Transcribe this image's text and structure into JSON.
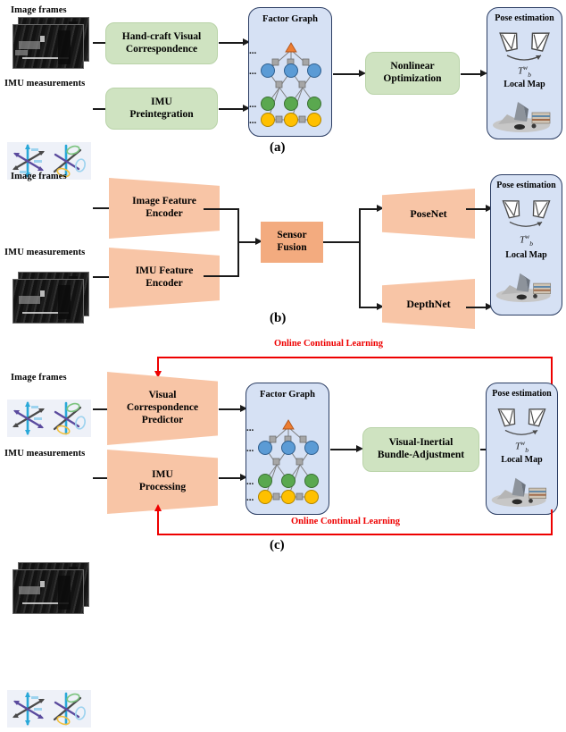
{
  "figure": {
    "panels": [
      {
        "letter": "(a)",
        "inputs": [
          {
            "label": "Image frames",
            "icon": "image-frames-icon"
          },
          {
            "label": "IMU measurements",
            "icon": "imu-axes-icon"
          }
        ],
        "blocks": [
          {
            "label": "Hand-craft Visual Correspondence",
            "line1": "Hand-craft Visual",
            "line2": "Correspondence",
            "style": "green-rounded"
          },
          {
            "label": "IMU Preintegration",
            "line1": "IMU",
            "line2": "Preintegration",
            "style": "green-rounded"
          },
          {
            "label": "Nonlinear Optimization",
            "line1": "Nonlinear",
            "line2": "Optimization",
            "style": "green-rounded"
          }
        ],
        "factor_graph": {
          "title": "Factor Graph",
          "ellipsis": "..."
        },
        "output": {
          "pose_title": "Pose estimation",
          "transform": "T",
          "transform_sup": "w",
          "transform_sub": "b",
          "map_title": "Local Map"
        }
      },
      {
        "letter": "(b)",
        "inputs": [
          {
            "label": "Image frames",
            "icon": "image-frames-icon"
          },
          {
            "label": "IMU measurements",
            "icon": "imu-axes-icon"
          }
        ],
        "blocks": [
          {
            "label": "Image Feature Encoder",
            "line1": "Image Feature",
            "line2": "Encoder",
            "style": "salmon-trapezoid-encoder"
          },
          {
            "label": "IMU Feature Encoder",
            "line1": "IMU Feature",
            "line2": "Encoder",
            "style": "salmon-trapezoid-encoder"
          },
          {
            "label": "Sensor Fusion",
            "line1": "Sensor",
            "line2": "Fusion",
            "style": "salmon-rect"
          },
          {
            "label": "PoseNet",
            "line1": "PoseNet",
            "line2": "",
            "style": "salmon-trapezoid-decoder"
          },
          {
            "label": "DepthNet",
            "line1": "DepthNet",
            "line2": "",
            "style": "salmon-trapezoid-decoder"
          }
        ],
        "output": {
          "pose_title": "Pose estimation",
          "transform": "T",
          "transform_sup": "w",
          "transform_sub": "b",
          "map_title": "Local Map"
        }
      },
      {
        "letter": "(c)",
        "inputs": [
          {
            "label": "Image frames",
            "icon": "image-frames-icon"
          },
          {
            "label": "IMU measurements",
            "icon": "imu-axes-icon"
          }
        ],
        "blocks": [
          {
            "label": "Visual Correspondence Predictor",
            "line1": "Visual",
            "line2": "Correspondence",
            "line3": "Predictor",
            "style": "salmon-trapezoid-encoder"
          },
          {
            "label": "IMU Processing",
            "line1": "IMU",
            "line2": "Processing",
            "style": "salmon-trapezoid-encoder"
          },
          {
            "label": "Visual-Inertial Bundle-Adjustment",
            "line1": "Visual-Inertial",
            "line2": "Bundle-Adjustment",
            "style": "green-rounded"
          }
        ],
        "factor_graph": {
          "title": "Factor Graph",
          "ellipsis": "..."
        },
        "output": {
          "pose_title": "Pose estimation",
          "transform": "T",
          "transform_sup": "w",
          "transform_sub": "b",
          "map_title": "Local Map"
        },
        "feedback": [
          {
            "label": "Online Continual Learning",
            "position": "top"
          },
          {
            "label": "Online Continual Learning",
            "position": "bottom"
          }
        ]
      }
    ],
    "colors": {
      "green_block": "#cfe3c1",
      "salmon_light": "#f8c5a6",
      "salmon_dark": "#f3ab7f",
      "panel_fill": "#d6e1f4",
      "panel_border": "#2b3d63",
      "feedback_red": "#ee0000",
      "node_blue": "#5b9bd5",
      "node_green": "#5aa84f",
      "node_yellow": "#ffc000",
      "node_orange": "#ed7d31",
      "factor_gray": "#a6a6a6"
    }
  }
}
